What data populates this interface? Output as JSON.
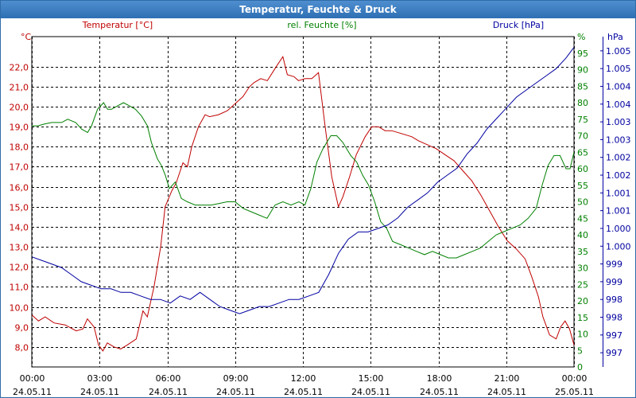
{
  "window": {
    "title": "Temperatur, Feuchte & Druck"
  },
  "colors": {
    "temperature": "#c00000",
    "humidity": "#008000",
    "pressure": "#0000a0",
    "grid": "#000000",
    "title_bar": "#2e6fb3"
  },
  "chart_data": {
    "type": "line",
    "title": "Temperatur, Feuchte & Druck",
    "grid": true,
    "x_ticks": [
      {
        "hours": 0,
        "time": "00:00",
        "date": "24.05.11"
      },
      {
        "hours": 3,
        "time": "03:00",
        "date": "24.05.11"
      },
      {
        "hours": 6,
        "time": "06:00",
        "date": "24.05.11"
      },
      {
        "hours": 9,
        "time": "09:00",
        "date": "24.05.11"
      },
      {
        "hours": 12,
        "time": "12:00",
        "date": "24.05.11"
      },
      {
        "hours": 15,
        "time": "15:00",
        "date": "24.05.11"
      },
      {
        "hours": 18,
        "time": "18:00",
        "date": "24.05.11"
      },
      {
        "hours": 21,
        "time": "21:00",
        "date": "24.05.11"
      },
      {
        "hours": 24,
        "time": "00:00",
        "date": "25.05.11"
      }
    ],
    "xlim": [
      0,
      24
    ],
    "axes": {
      "temperature": {
        "label": "Temperatur [°C]",
        "unit": "°C",
        "ylim": [
          7.0,
          23.5
        ],
        "ticks": [
          "8,0",
          "9,0",
          "10,0",
          "11,0",
          "12,0",
          "13,0",
          "14,0",
          "15,0",
          "16,0",
          "17,0",
          "18,0",
          "19,0",
          "20,0",
          "21,0",
          "22,0"
        ],
        "tick_values": [
          8,
          9,
          10,
          11,
          12,
          13,
          14,
          15,
          16,
          17,
          18,
          19,
          20,
          21,
          22
        ]
      },
      "humidity": {
        "label": "rel. Feuchte [%]",
        "unit": "%",
        "ylim": [
          0,
          100
        ],
        "ticks": [
          "0",
          "5",
          "10",
          "15",
          "20",
          "25",
          "30",
          "35",
          "40",
          "45",
          "50",
          "55",
          "60",
          "65",
          "70",
          "75",
          "80",
          "85",
          "90",
          "95"
        ],
        "tick_values": [
          0,
          5,
          10,
          15,
          20,
          25,
          30,
          35,
          40,
          45,
          50,
          55,
          60,
          65,
          70,
          75,
          80,
          85,
          90,
          95
        ]
      },
      "pressure": {
        "label": "Druck [hPa]",
        "unit": "hPa",
        "ylim": [
          996.6,
          1005.9
        ],
        "ticks": [
          "997",
          "997",
          "998",
          "998",
          "999",
          "999",
          "1.000",
          "1.000",
          "1.001",
          "1.001",
          "1.002",
          "1.002",
          "1.003",
          "1.003",
          "1.004",
          "1.004",
          "1.005",
          "1.005"
        ],
        "tick_values": [
          997.0,
          997.5,
          998.0,
          998.5,
          999.0,
          999.5,
          1000.0,
          1000.5,
          1001.0,
          1001.5,
          1002.0,
          1002.5,
          1003.0,
          1003.5,
          1004.0,
          1004.5,
          1005.0,
          1005.5
        ]
      }
    },
    "series": [
      {
        "name": "Temperatur [°C]",
        "axis": "temperature",
        "points": [
          [
            0,
            9.6
          ],
          [
            0.3,
            9.3
          ],
          [
            0.6,
            9.5
          ],
          [
            1.0,
            9.2
          ],
          [
            1.5,
            9.1
          ],
          [
            2.0,
            8.8
          ],
          [
            2.3,
            8.9
          ],
          [
            2.5,
            9.4
          ],
          [
            2.8,
            9.0
          ],
          [
            3.0,
            8.1
          ],
          [
            3.2,
            7.8
          ],
          [
            3.4,
            8.2
          ],
          [
            3.7,
            8.0
          ],
          [
            4.0,
            7.9
          ],
          [
            4.3,
            8.1
          ],
          [
            4.7,
            8.4
          ],
          [
            5.0,
            9.8
          ],
          [
            5.2,
            9.5
          ],
          [
            5.5,
            11.0
          ],
          [
            5.8,
            13.0
          ],
          [
            6.0,
            15.0
          ],
          [
            6.3,
            15.8
          ],
          [
            6.5,
            16.2
          ],
          [
            6.8,
            17.2
          ],
          [
            7.0,
            17.0
          ],
          [
            7.2,
            18.0
          ],
          [
            7.5,
            19.0
          ],
          [
            7.8,
            19.6
          ],
          [
            8.0,
            19.5
          ],
          [
            8.4,
            19.6
          ],
          [
            8.8,
            19.8
          ],
          [
            9.2,
            20.2
          ],
          [
            9.5,
            20.5
          ],
          [
            9.8,
            21.0
          ],
          [
            10.0,
            21.2
          ],
          [
            10.3,
            21.4
          ],
          [
            10.6,
            21.3
          ],
          [
            11.0,
            22.0
          ],
          [
            11.3,
            22.5
          ],
          [
            11.5,
            21.6
          ],
          [
            11.8,
            21.5
          ],
          [
            12.0,
            21.3
          ],
          [
            12.3,
            21.4
          ],
          [
            12.6,
            21.4
          ],
          [
            12.9,
            21.7
          ],
          [
            13.2,
            19.0
          ],
          [
            13.5,
            16.5
          ],
          [
            13.8,
            15.0
          ],
          [
            14.0,
            15.5
          ],
          [
            14.3,
            16.5
          ],
          [
            14.6,
            17.6
          ],
          [
            15.0,
            18.5
          ],
          [
            15.3,
            19.0
          ],
          [
            15.6,
            19.0
          ],
          [
            15.9,
            18.8
          ],
          [
            16.2,
            18.8
          ],
          [
            16.5,
            18.7
          ],
          [
            16.8,
            18.6
          ],
          [
            17.1,
            18.5
          ],
          [
            17.4,
            18.3
          ],
          [
            17.8,
            18.1
          ],
          [
            18.2,
            17.9
          ],
          [
            18.6,
            17.6
          ],
          [
            19.0,
            17.3
          ],
          [
            19.4,
            16.8
          ],
          [
            19.8,
            16.3
          ],
          [
            20.2,
            15.6
          ],
          [
            20.6,
            14.8
          ],
          [
            21.0,
            14.0
          ],
          [
            21.4,
            13.3
          ],
          [
            21.8,
            12.9
          ],
          [
            22.2,
            12.4
          ],
          [
            22.5,
            11.5
          ],
          [
            22.8,
            10.5
          ],
          [
            23.0,
            9.5
          ],
          [
            23.3,
            8.6
          ],
          [
            23.6,
            8.4
          ],
          [
            23.8,
            9.0
          ],
          [
            24.0,
            9.3
          ],
          [
            24.2,
            8.9
          ],
          [
            24.4,
            8.1
          ]
        ]
      },
      {
        "name": "rel. Feuchte [%]",
        "axis": "humidity",
        "points": [
          [
            0,
            73
          ],
          [
            0.3,
            73
          ],
          [
            0.6,
            73.5
          ],
          [
            1.0,
            74
          ],
          [
            1.5,
            74
          ],
          [
            1.8,
            75
          ],
          [
            2.2,
            74
          ],
          [
            2.5,
            72
          ],
          [
            2.8,
            71
          ],
          [
            3.0,
            73
          ],
          [
            3.3,
            78
          ],
          [
            3.6,
            80
          ],
          [
            3.8,
            78
          ],
          [
            4.0,
            78
          ],
          [
            4.3,
            79
          ],
          [
            4.6,
            80
          ],
          [
            4.9,
            79
          ],
          [
            5.2,
            78
          ],
          [
            5.5,
            76
          ],
          [
            5.8,
            73
          ],
          [
            6.0,
            68
          ],
          [
            6.3,
            63
          ],
          [
            6.5,
            61
          ],
          [
            6.7,
            58
          ],
          [
            6.9,
            54
          ],
          [
            7.2,
            56
          ],
          [
            7.5,
            51
          ],
          [
            7.8,
            50
          ],
          [
            8.2,
            49
          ],
          [
            8.6,
            49
          ],
          [
            9.0,
            49
          ],
          [
            9.4,
            49.5
          ],
          [
            9.8,
            50
          ],
          [
            10.2,
            50
          ],
          [
            10.6,
            48
          ],
          [
            11.0,
            47
          ],
          [
            11.4,
            46
          ],
          [
            11.8,
            45
          ],
          [
            12.2,
            49
          ],
          [
            12.6,
            50
          ],
          [
            13.0,
            49
          ],
          [
            13.4,
            50
          ],
          [
            13.7,
            49
          ],
          [
            14.0,
            54
          ],
          [
            14.3,
            62
          ],
          [
            14.6,
            66
          ],
          [
            15.0,
            70
          ],
          [
            15.3,
            70
          ],
          [
            15.6,
            68
          ],
          [
            16.0,
            64
          ],
          [
            16.3,
            62
          ],
          [
            16.6,
            58
          ],
          [
            16.9,
            55
          ],
          [
            17.2,
            50
          ],
          [
            17.5,
            44
          ],
          [
            17.8,
            42
          ],
          [
            18.1,
            38
          ],
          [
            18.5,
            37
          ],
          [
            18.9,
            36
          ],
          [
            19.3,
            35
          ],
          [
            19.7,
            34
          ],
          [
            20.1,
            35
          ],
          [
            20.5,
            34
          ],
          [
            20.9,
            33
          ],
          [
            21.3,
            33
          ],
          [
            21.7,
            34
          ],
          [
            22.1,
            35
          ],
          [
            22.5,
            36
          ],
          [
            22.9,
            38
          ],
          [
            23.3,
            40
          ],
          [
            23.7,
            41
          ],
          [
            24.1,
            42
          ],
          [
            24.5,
            43
          ],
          [
            24.9,
            45
          ],
          [
            25.3,
            48
          ],
          [
            25.6,
            55
          ],
          [
            25.9,
            61
          ],
          [
            26.2,
            64
          ],
          [
            26.5,
            64
          ],
          [
            26.8,
            60
          ],
          [
            27.0,
            60
          ],
          [
            27.2,
            65
          ]
        ]
      },
      {
        "name": "Druck [hPa]",
        "axis": "pressure",
        "points": [
          [
            0,
            999.7
          ],
          [
            0.5,
            999.6
          ],
          [
            1.0,
            999.5
          ],
          [
            1.5,
            999.4
          ],
          [
            2.0,
            999.2
          ],
          [
            2.5,
            999.0
          ],
          [
            3.0,
            998.9
          ],
          [
            3.5,
            998.8
          ],
          [
            4.0,
            998.8
          ],
          [
            4.5,
            998.7
          ],
          [
            5.0,
            998.7
          ],
          [
            5.5,
            998.6
          ],
          [
            6.0,
            998.5
          ],
          [
            6.5,
            998.5
          ],
          [
            7.0,
            998.4
          ],
          [
            7.5,
            998.6
          ],
          [
            8.0,
            998.5
          ],
          [
            8.5,
            998.7
          ],
          [
            9.0,
            998.5
          ],
          [
            9.5,
            998.3
          ],
          [
            10.0,
            998.2
          ],
          [
            10.5,
            998.1
          ],
          [
            11.0,
            998.2
          ],
          [
            11.5,
            998.3
          ],
          [
            12.0,
            998.3
          ],
          [
            12.5,
            998.4
          ],
          [
            13.0,
            998.5
          ],
          [
            13.5,
            998.5
          ],
          [
            14.0,
            998.6
          ],
          [
            14.5,
            998.7
          ],
          [
            15.0,
            999.2
          ],
          [
            15.5,
            999.8
          ],
          [
            16.0,
            1000.2
          ],
          [
            16.5,
            1000.4
          ],
          [
            17.0,
            1000.4
          ],
          [
            17.5,
            1000.5
          ],
          [
            18.0,
            1000.6
          ],
          [
            18.5,
            1000.8
          ],
          [
            19.0,
            1001.1
          ],
          [
            19.5,
            1001.3
          ],
          [
            20.0,
            1001.5
          ],
          [
            20.5,
            1001.8
          ],
          [
            21.0,
            1002.0
          ],
          [
            21.5,
            1002.2
          ],
          [
            22.0,
            1002.6
          ],
          [
            22.5,
            1002.9
          ],
          [
            23.0,
            1003.3
          ],
          [
            23.5,
            1003.6
          ],
          [
            24.0,
            1003.9
          ],
          [
            24.5,
            1004.2
          ],
          [
            25.0,
            1004.4
          ],
          [
            25.5,
            1004.6
          ],
          [
            26.0,
            1004.8
          ],
          [
            26.5,
            1005.0
          ],
          [
            27.0,
            1005.3
          ],
          [
            27.4,
            1005.6
          ]
        ]
      }
    ]
  }
}
